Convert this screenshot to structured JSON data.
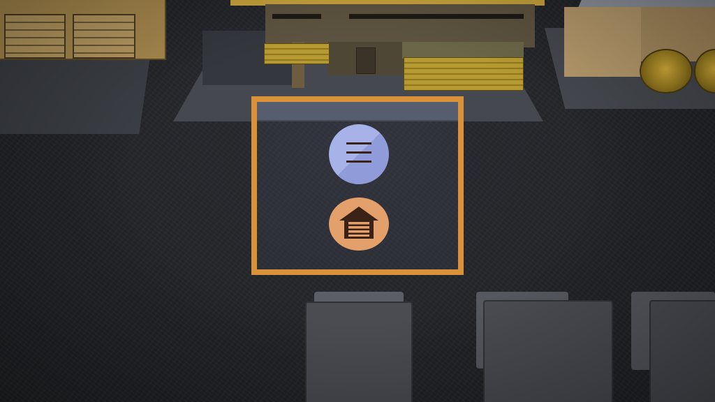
{
  "scene": {
    "description_free": true
  },
  "colors": {
    "selection_border": "#d9913a",
    "menu_button_bg": "#a7b2e8",
    "garage_button_bg": "#e3a06a",
    "icon_dark": "#3b2216"
  },
  "icons": {
    "menu": "hamburger-menu-icon",
    "garage": "garage-icon"
  }
}
